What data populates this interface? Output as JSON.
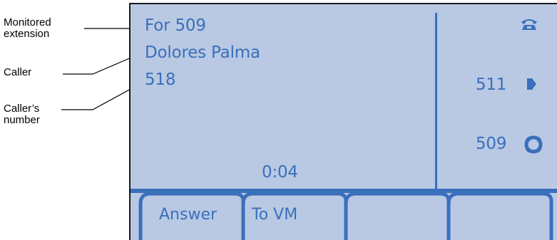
{
  "callouts": {
    "monitored_extension": "Monitored extension",
    "caller": "Caller",
    "callers_number": "Caller’s number"
  },
  "display": {
    "line1": "For  509",
    "line2": "Dolores Palma",
    "line3": "518",
    "timer": "0:04"
  },
  "lines": [
    {
      "number": "",
      "icon": "phone-icon"
    },
    {
      "number": "511",
      "icon": "arrow-icon"
    },
    {
      "number": "509",
      "icon": "hold-icon"
    }
  ],
  "softkeys": [
    "Answer",
    "To VM",
    "",
    ""
  ],
  "colors": {
    "screen_background": "#b9c9e3",
    "display_text": "#3a6fbc",
    "callout_text": "#000000"
  }
}
